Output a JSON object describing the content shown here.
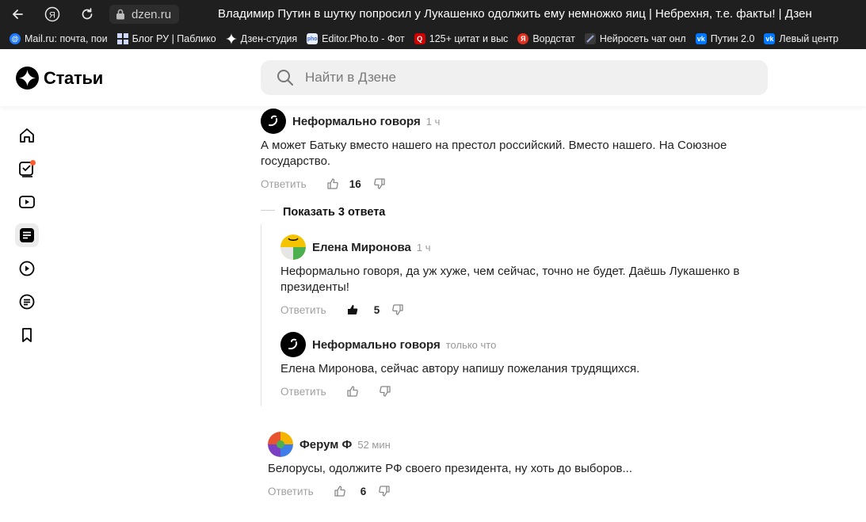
{
  "browser": {
    "url": "dzen.ru",
    "title": "Владимир Путин в шутку попросил у Лукашенко одолжить ему немножко яиц | Небрехня, т.е. факты! | Дзен"
  },
  "bookmarks": [
    {
      "label": "Mail.ru: почта, пои",
      "icon": "mailru-icon",
      "color": "#1f79ff"
    },
    {
      "label": "Блог РУ | Паблико",
      "icon": "grid-icon",
      "color": "#4a4a4a"
    },
    {
      "label": "Дзен-студия",
      "icon": "dzen-icon",
      "color": "#000000"
    },
    {
      "label": "Editor.Pho.to - Фот",
      "icon": "photo-icon",
      "color": "#3c6bd6"
    },
    {
      "label": "125+ цитат и выс",
      "icon": "q-icon",
      "color": "#d00000"
    },
    {
      "label": "Вордстат",
      "icon": "yandex-icon",
      "color": "#e03020"
    },
    {
      "label": "Нейросеть чат онл",
      "icon": "ai-icon",
      "color": "#3a3a3a"
    },
    {
      "label": "Путин 2.0",
      "icon": "vk-icon",
      "color": "#0077ff"
    },
    {
      "label": "Левый центр",
      "icon": "vk-icon",
      "color": "#0077ff"
    }
  ],
  "header": {
    "logo_text": "Статьи",
    "search_placeholder": "Найти в Дзене"
  },
  "sidebar": [
    {
      "name": "home-icon",
      "active": false
    },
    {
      "name": "subscriptions-icon",
      "active": false
    },
    {
      "name": "video-icon",
      "active": false
    },
    {
      "name": "articles-icon",
      "active": true
    },
    {
      "name": "shorts-icon",
      "active": false
    },
    {
      "name": "channels-icon",
      "active": false
    },
    {
      "name": "bookmark-icon",
      "active": false
    }
  ],
  "comments": {
    "c1": {
      "author": "Неформально говоря",
      "time": "1 ч",
      "text": "А может Батьку вместо нашего на престол российский. Вместо нашего. На Союзное государство.",
      "reply": "Ответить",
      "likes": "16"
    },
    "show_replies": "Показать 3 ответа",
    "r1": {
      "author": "Елена Миронова",
      "time": "1 ч",
      "text": "Неформально говоря, да уж хуже, чем сейчас, точно не будет. Даёшь Лукашенко в президенты!",
      "reply": "Ответить",
      "likes": "5"
    },
    "r2": {
      "author": "Неформально говоря",
      "time": "только что",
      "text": "Елена Миронова, сейчас автору напишу пожелания трудящихся.",
      "reply": "Ответить"
    },
    "c2": {
      "author": "Ферум Ф",
      "time": "52 мин",
      "text": "Белорусы, одолжите РФ своего президента, ну хоть до выборов...",
      "reply": "Ответить",
      "likes": "6"
    }
  }
}
